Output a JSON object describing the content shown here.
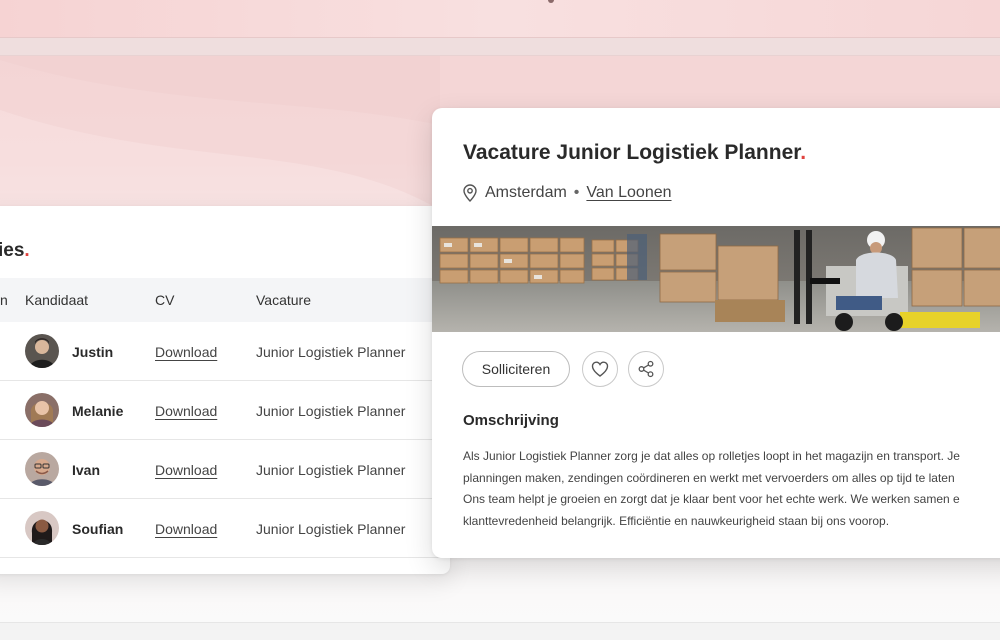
{
  "table": {
    "heading_partial": "ies",
    "columns": {
      "first_partial": "n",
      "candidate": "Kandidaat",
      "cv": "CV",
      "vacancy": "Vacature"
    },
    "rows": [
      {
        "name": "Justin",
        "cv": "Download",
        "vacancy": "Junior Logistiek Planner"
      },
      {
        "name": "Melanie",
        "cv": "Download",
        "vacancy": "Junior Logistiek Planner"
      },
      {
        "name": "Ivan",
        "cv": "Download",
        "vacancy": "Junior Logistiek Planner"
      },
      {
        "name": "Soufian",
        "cv": "Download",
        "vacancy": "Junior Logistiek Planner"
      }
    ]
  },
  "detail": {
    "title": "Vacature Junior Logistiek Planner",
    "location": "Amsterdam",
    "separator": "•",
    "company": "Van Loonen",
    "apply_label": "Solliciteren",
    "favorite_icon": "heart-icon",
    "share_icon": "share-icon",
    "section_title": "Omschrijving",
    "description_lines": [
      "Als Junior Logistiek Planner zorg je dat alles op rolletjes loopt in het magazijn en transport. Je",
      "planningen maken, zendingen coördineren en werkt met vervoerders om alles op tijd te laten",
      "Ons team helpt je groeien en zorgt dat je klaar bent voor het echte werk. We werken samen e",
      "klanttevredenheid belangrijk. Efficiëntie en nauwkeurigheid staan bij ons voorop."
    ]
  },
  "accent_color": "#e0433f"
}
